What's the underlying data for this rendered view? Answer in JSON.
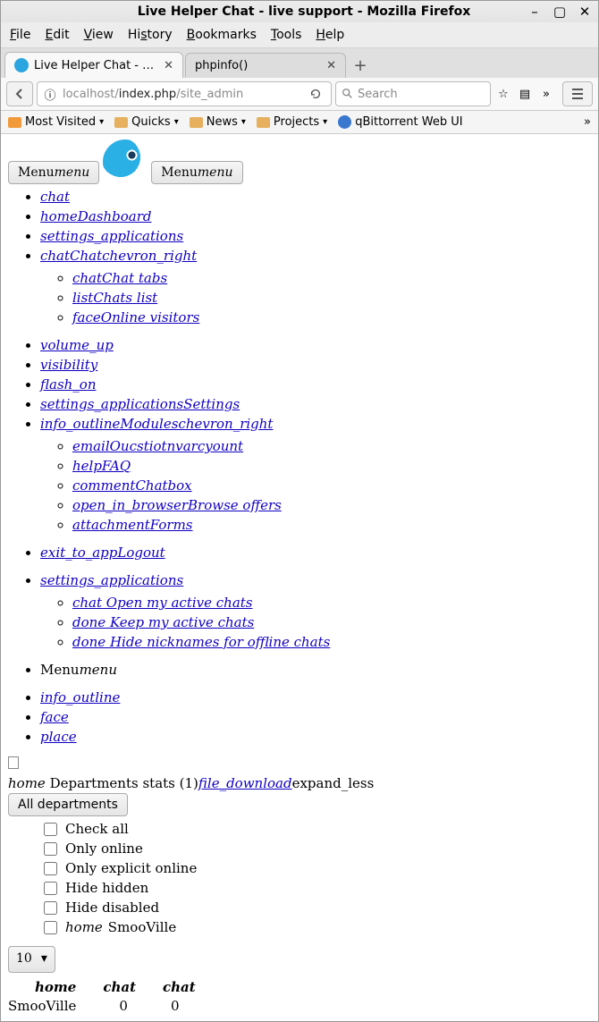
{
  "window": {
    "title": "Live Helper Chat - live support - Mozilla Firefox"
  },
  "menubar": [
    "File",
    "Edit",
    "View",
    "History",
    "Bookmarks",
    "Tools",
    "Help"
  ],
  "tabs": [
    {
      "label": "Live Helper Chat - liv...",
      "active": true
    },
    {
      "label": "phpinfo()",
      "active": false
    }
  ],
  "url": {
    "gray_prefix": "localhost/",
    "dark": "index.php",
    "gray_suffix": "/site_admin"
  },
  "search": {
    "placeholder": "Search"
  },
  "bookmarks": {
    "most_visited": "Most Visited",
    "quicks": "Quicks",
    "news": "News",
    "projects": "Projects",
    "qbit": "qBittorrent Web UI"
  },
  "page": {
    "menu_label": "Menu",
    "menu_icon": "menu",
    "links_outer": [
      {
        "t": "chat"
      },
      {
        "t": "homeDashboard"
      },
      {
        "t": "settings_applications"
      },
      {
        "t": "chatChatchevron_right"
      },
      {
        "t": "volume_up"
      },
      {
        "t": "visibility"
      },
      {
        "t": "flash_on"
      },
      {
        "t": "settings_applicationsSettings"
      },
      {
        "t": "info_outlineModuleschevron_right"
      },
      {
        "t": "exit_to_appLogout"
      }
    ],
    "links_inner1": [
      "chatChat tabs",
      "listChats list",
      "faceOnline visitors"
    ],
    "links_inner2": [
      "emailOucstiotnvarcyount",
      "helpFAQ",
      "commentChatbox",
      "open_in_browserBrowse offers",
      "attachmentForms"
    ],
    "section2_head": "settings_applications",
    "section2_items": [
      "chat Open my active chats",
      "done Keep my active chats",
      "done Hide nicknames for offline chats"
    ],
    "menu_line": {
      "a": "Menu",
      "b": "menu"
    },
    "sole_items": [
      "info_outline",
      "face",
      "place"
    ],
    "home_line": {
      "icon": "home",
      "text": " Departments stats (1)",
      "link": "file_download",
      "tail": "expand_less"
    },
    "all_departments": "All departments",
    "checks": [
      "Check all",
      "Only online",
      "Only explicit online",
      "Hide hidden",
      "Hide disabled"
    ],
    "last_check": {
      "icon": "home",
      "label": "SmooVille"
    },
    "select_value": "10",
    "table": {
      "headers": [
        "home",
        "chat",
        "chat"
      ],
      "row": [
        "SmooVille",
        "0",
        "0"
      ]
    }
  }
}
